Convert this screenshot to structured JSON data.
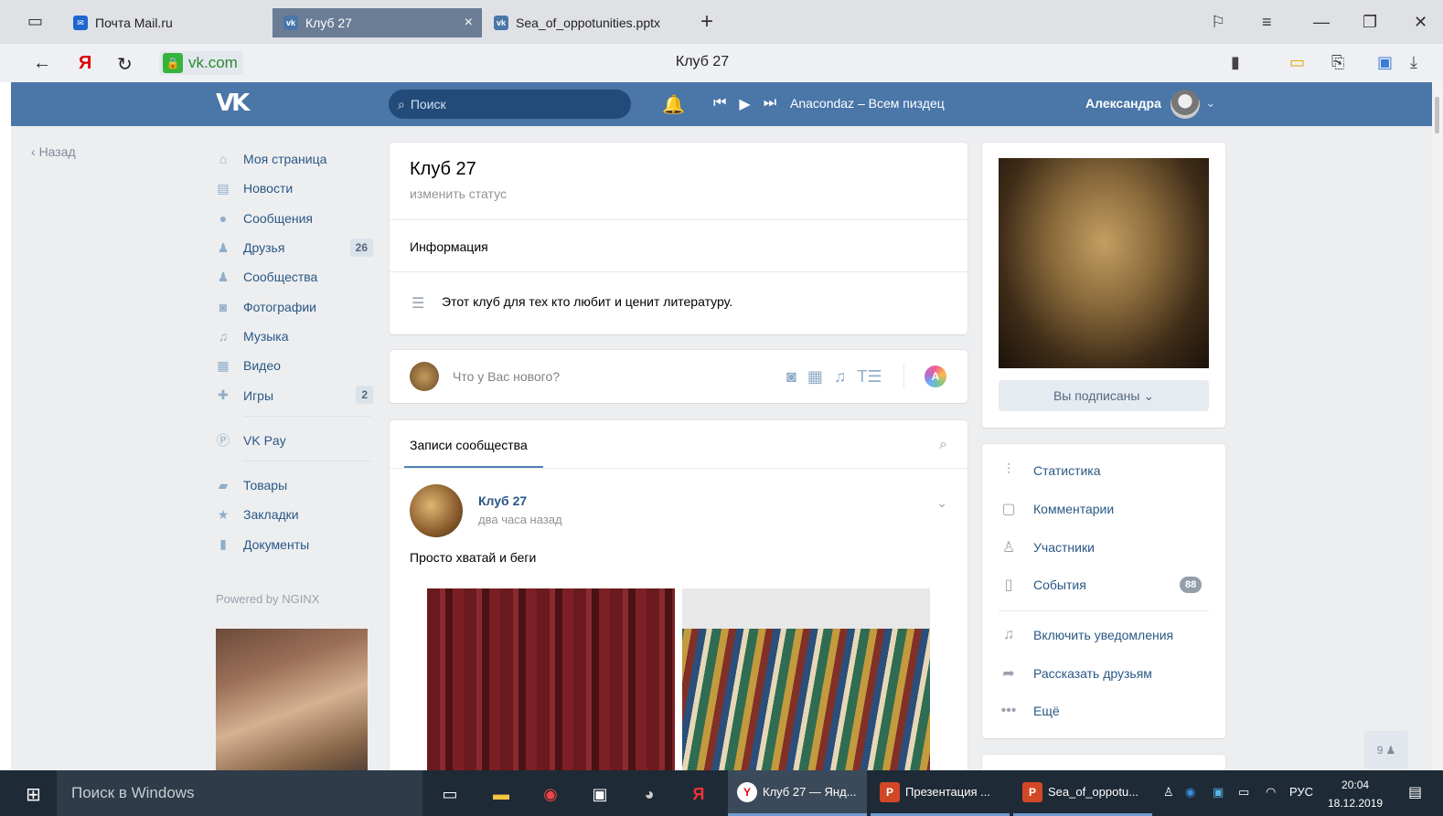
{
  "browser": {
    "tabs": [
      {
        "label": "Почта Mail.ru"
      },
      {
        "label": "Клуб 27"
      },
      {
        "label": "Sea_of_oppotunities.pptx"
      }
    ],
    "address": "vk.com",
    "page_title": "Клуб 27"
  },
  "header": {
    "logo": "VK",
    "search_placeholder": "Поиск",
    "track": "Anacondaz – Всем пиздец",
    "user_name": "Александра"
  },
  "nav": {
    "back": "Назад",
    "items": [
      {
        "label": "Моя страница",
        "icon": "home-icon",
        "glyph": "⌂"
      },
      {
        "label": "Новости",
        "icon": "news-icon",
        "glyph": "▤"
      },
      {
        "label": "Сообщения",
        "icon": "messages-icon",
        "glyph": "●"
      },
      {
        "label": "Друзья",
        "icon": "friend-icon",
        "glyph": "♟",
        "count": "26"
      },
      {
        "label": "Сообщества",
        "icon": "groups-icon",
        "glyph": "♟"
      },
      {
        "label": "Фотографии",
        "icon": "camera-icon",
        "glyph": "◙"
      },
      {
        "label": "Музыка",
        "icon": "music-icon",
        "glyph": "♫"
      },
      {
        "label": "Видео",
        "icon": "video-icon",
        "glyph": "▦"
      },
      {
        "label": "Игры",
        "icon": "gamepad-icon",
        "glyph": "✚",
        "count": "2"
      }
    ],
    "vkpay": "VK Pay",
    "items2": [
      {
        "label": "Товары",
        "icon": "bag-icon",
        "glyph": "▰"
      },
      {
        "label": "Закладки",
        "icon": "star-icon",
        "glyph": "★"
      },
      {
        "label": "Документы",
        "icon": "document-icon",
        "glyph": "▮"
      }
    ],
    "powered": "Powered by NGINX"
  },
  "group": {
    "name": "Клуб 27",
    "status": "изменить статус",
    "info_label": "Информация",
    "description": "Этот клуб для тех кто любит и ценит литературу."
  },
  "post_box": {
    "placeholder": "Что у Вас нового?"
  },
  "feed": {
    "tab": "Записи сообщества",
    "post": {
      "author": "Клуб 27",
      "time": "два часа назад",
      "text": "Просто хватай и беги"
    }
  },
  "right": {
    "subscribe": "Вы подписаны",
    "links": [
      {
        "label": "Статистика",
        "icon": "stats-icon",
        "glyph": "⫶"
      },
      {
        "label": "Комментарии",
        "icon": "comment-icon",
        "glyph": "▢"
      },
      {
        "label": "Участники",
        "icon": "user-icon",
        "glyph": "♙"
      },
      {
        "label": "События",
        "icon": "calendar-icon",
        "glyph": "▯",
        "count": "88"
      },
      {
        "label": "Включить уведомления",
        "icon": "bell-icon",
        "glyph": "🔔"
      },
      {
        "label": "Рассказать друзьям",
        "icon": "share-icon",
        "glyph": "➦"
      },
      {
        "label": "Ещё",
        "icon": "more-icon",
        "glyph": "•••"
      }
    ]
  },
  "online_count": "9",
  "taskbar": {
    "search": "Поиск в Windows",
    "apps": [
      {
        "label": "Клуб 27 — Янд..."
      },
      {
        "label": "Презентация ..."
      },
      {
        "label": "Sea_of_oppotu..."
      }
    ],
    "lang": "РУС",
    "time": "20:04",
    "date": "18.12.2019"
  }
}
